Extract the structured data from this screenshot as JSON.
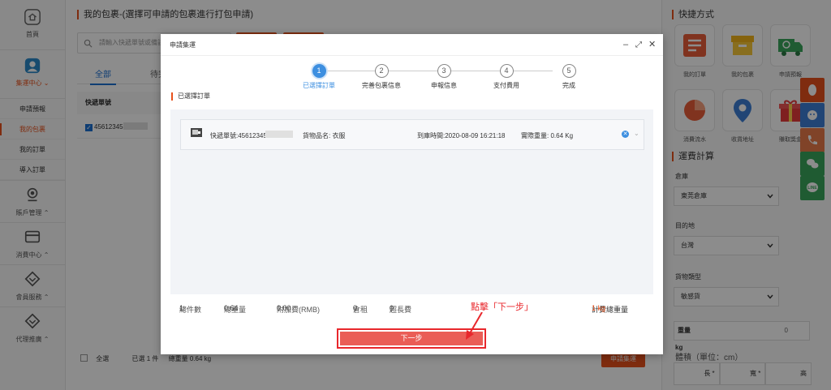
{
  "sidebar": {
    "home": "首頁",
    "collect_center": "集運中心",
    "sub_items": [
      "申請預報",
      "我的包裹",
      "我的訂單",
      "導入訂單"
    ],
    "groups": [
      "賬戶管理",
      "消費中心",
      "會員服務",
      "代理推廣"
    ]
  },
  "main": {
    "title": "我的包裹-(選擇可申請的包裹進行打包申請)",
    "search_placeholder": "請輸入快遞單號或備註",
    "tabs": [
      "全部",
      "待完善"
    ],
    "table_header": "快遞單號",
    "row_tracking": "45612345",
    "footer": {
      "select_all": "全選",
      "selected": "已選 1 件",
      "total_weight": "總重量 0.64 kg",
      "submit": "申請集運"
    }
  },
  "right_panel": {
    "title": "快捷方式",
    "quick": [
      "我的訂單",
      "我的包裹",
      "申請預報",
      "消費流水",
      "收貨地址",
      "賺取獎金"
    ],
    "calc_title": "運費計算",
    "warehouse_label": "倉庫",
    "warehouse_value": "東莞倉庫",
    "dest_label": "目的地",
    "dest_value": "台灣",
    "type_label": "貨物類型",
    "type_value": "敏感貨",
    "weight_label": "重量",
    "weight_value": "0",
    "weight_unit": "kg",
    "volume_label": "體積（單位：cm）",
    "dims": [
      "長",
      "寬",
      "高"
    ]
  },
  "modal": {
    "title": "申請集運",
    "steps": [
      {
        "num": "1",
        "label": "已選擇訂單"
      },
      {
        "num": "2",
        "label": "完善包裹信息"
      },
      {
        "num": "3",
        "label": "申報信息"
      },
      {
        "num": "4",
        "label": "支付費用"
      },
      {
        "num": "5",
        "label": "完成"
      }
    ],
    "active_step": 1,
    "section_label": "已選擇訂單",
    "order": {
      "tracking": "快遞單號:45612345",
      "goods": "貨物品名: 衣服",
      "arrival": "到庫時間:2020-08-09 16:21:18",
      "weight": "實際重量: 0.64 Kg"
    },
    "summary": {
      "count_label": "總件數",
      "count": "1",
      "weight_label": "總重量",
      "weight": "0.64",
      "extra_label": "附加費(RMB)",
      "extra": "0.00",
      "rent_label": "倉租",
      "rent": "0",
      "oversize_label": "超長費",
      "oversize": "0",
      "billing_label": "計費總重量",
      "billing": "1 kg"
    },
    "annotation": "點擊「下一步」",
    "next_label": "下一步"
  },
  "colors": {
    "accent": "#e8511c",
    "primary": "#3d8fe0",
    "annotation": "#e8272c"
  }
}
